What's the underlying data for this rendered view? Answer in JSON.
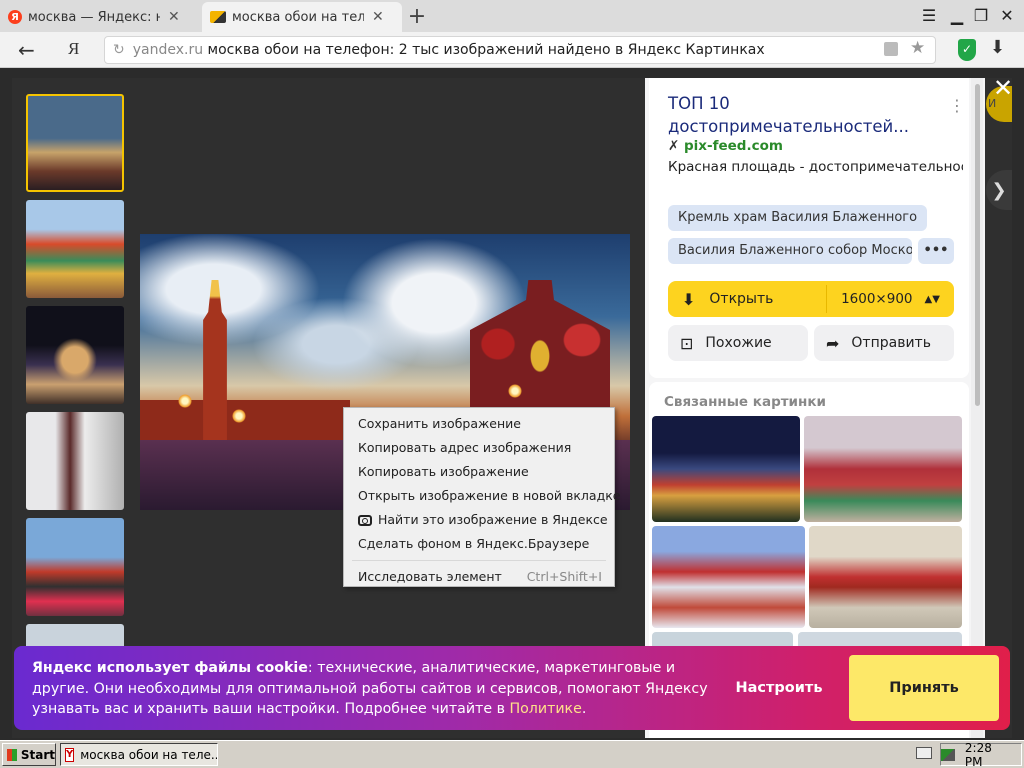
{
  "browser": {
    "tabs": [
      {
        "title": "москва — Яндекс: нашлось",
        "active": false
      },
      {
        "title": "москва обои на телефон",
        "active": true
      }
    ],
    "new_tab_icon": "+",
    "address": {
      "domain": "yandex.ru",
      "path": "москва обои на телефон: 2 тыс изображений найдено в Яндекс Картинках"
    },
    "nav_logo": "Я"
  },
  "context_menu": {
    "items": [
      "Сохранить изображение",
      "Копировать адрес изображения",
      "Копировать изображение",
      "Открыть изображение в новой вкладке",
      "Найти это изображение в Яндексе",
      "Сделать фоном в Яндекс.Браузере"
    ],
    "inspect": {
      "label": "Исследовать элемент",
      "shortcut": "Ctrl+Shift+I"
    }
  },
  "panel": {
    "title": "ТОП 10 достопримечательностей...",
    "source": "pix-feed.com",
    "description": "Красная площадь - достопримечательност...",
    "tags": [
      "Кремль храм Василия Блаженного",
      "Василия Блаженного собор Москов..."
    ],
    "more_tags": "•••",
    "open_label": "Открыть",
    "size": "1600×900",
    "similar_label": "Похожие",
    "share_label": "Отправить",
    "related_title": "Связанные картинки"
  },
  "cookie": {
    "bold": "Яндекс использует файлы cookie",
    "text": ": технические, аналитические, маркетинговые и другие. Они необходимы для оптимальной работы сайтов и сервисов, помогают Яндексу узнавать вас и хранить ваши настройки. Подробнее читайте в ",
    "link": "Политике",
    "end": ".",
    "settings_label": "Настроить",
    "accept_label": "Принять"
  },
  "taskbar": {
    "start_label": "Start",
    "task_label": "москва обои на теле...",
    "clock": "2:28 PM"
  },
  "colors": {
    "accent_yellow": "#fdd31f",
    "link_blue": "#1a2a7a",
    "source_green": "#2a8a2a",
    "cookie_gradient_start": "#6a2ad0",
    "cookie_gradient_end": "#e01f4a"
  }
}
